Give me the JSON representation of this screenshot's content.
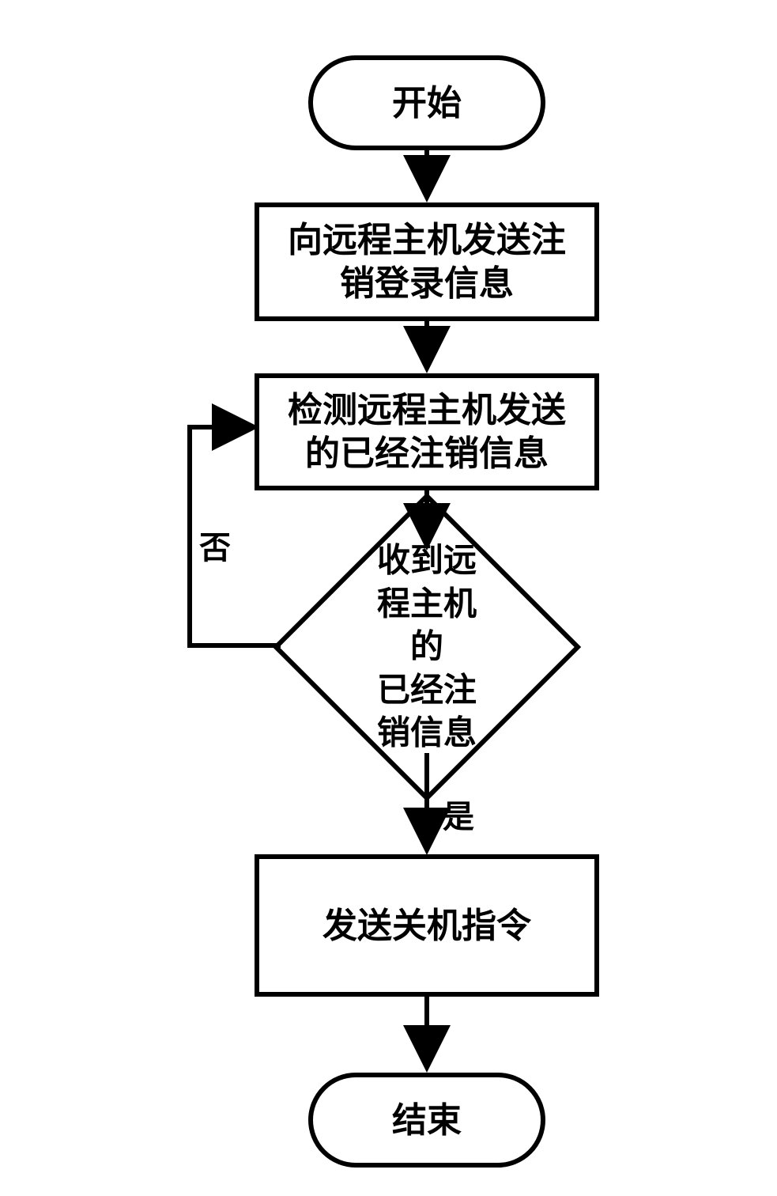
{
  "flow": {
    "start": "开始",
    "step1": "向远程主机发送注\n销登录信息",
    "step2": "检测远程主机发送\n的已经注销信息",
    "decision": "收到远程主机的\n已经注销信息",
    "no_label": "否",
    "yes_label": "是",
    "step3": "发送关机指令",
    "end": "结束"
  }
}
